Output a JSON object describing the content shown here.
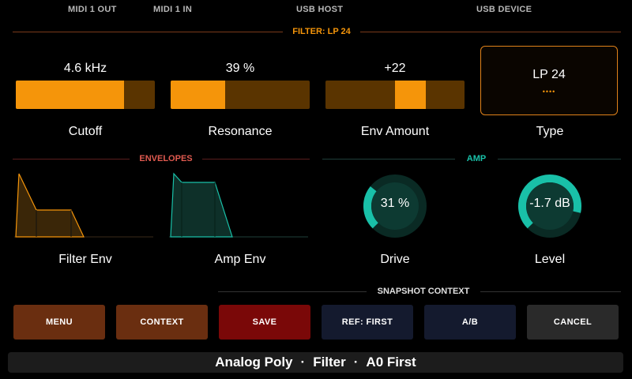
{
  "status_bar": {
    "midi1_out": "MIDI 1 OUT",
    "midi1_in": "MIDI 1 IN",
    "usb_host": "USB HOST",
    "usb_device": "USB DEVICE"
  },
  "filter_section": {
    "title": "FILTER: LP 24",
    "params": [
      {
        "label": "Cutoff",
        "value": "4.6 kHz",
        "fill_fraction": 0.78
      },
      {
        "label": "Resonance",
        "value": "39 %",
        "fill_fraction": 0.39
      },
      {
        "label": "Env Amount",
        "value": "+22",
        "fill_start": 0.5,
        "fill_end": 0.72
      }
    ],
    "type": {
      "label": "Type",
      "value": "LP 24",
      "indicator": "••••"
    }
  },
  "envelopes_section": {
    "title": "ENVELOPES",
    "filter_env": {
      "label": "Filter Env",
      "color": "#f5950a"
    },
    "amp_env": {
      "label": "Amp Env",
      "color": "#19c0a8"
    }
  },
  "amp_section": {
    "title": "AMP",
    "drive": {
      "label": "Drive",
      "value": "31 %",
      "level": 0.31
    },
    "level": {
      "label": "Level",
      "value": "-1.7 dB",
      "level": 0.88
    }
  },
  "snapshot_context": {
    "title": "SNAPSHOT CONTEXT"
  },
  "buttons": {
    "menu": "MENU",
    "context": "CONTEXT",
    "save": "SAVE",
    "ref": "REF: FIRST",
    "ab": "A/B",
    "cancel": "CANCEL"
  },
  "footer": {
    "patch": "Analog Poly",
    "page": "Filter",
    "snapshot": "A0 First",
    "separator": "·"
  },
  "colors": {
    "accent_orange": "#f5950a",
    "accent_teal": "#19c0a8",
    "section_red": "#e05a50"
  }
}
